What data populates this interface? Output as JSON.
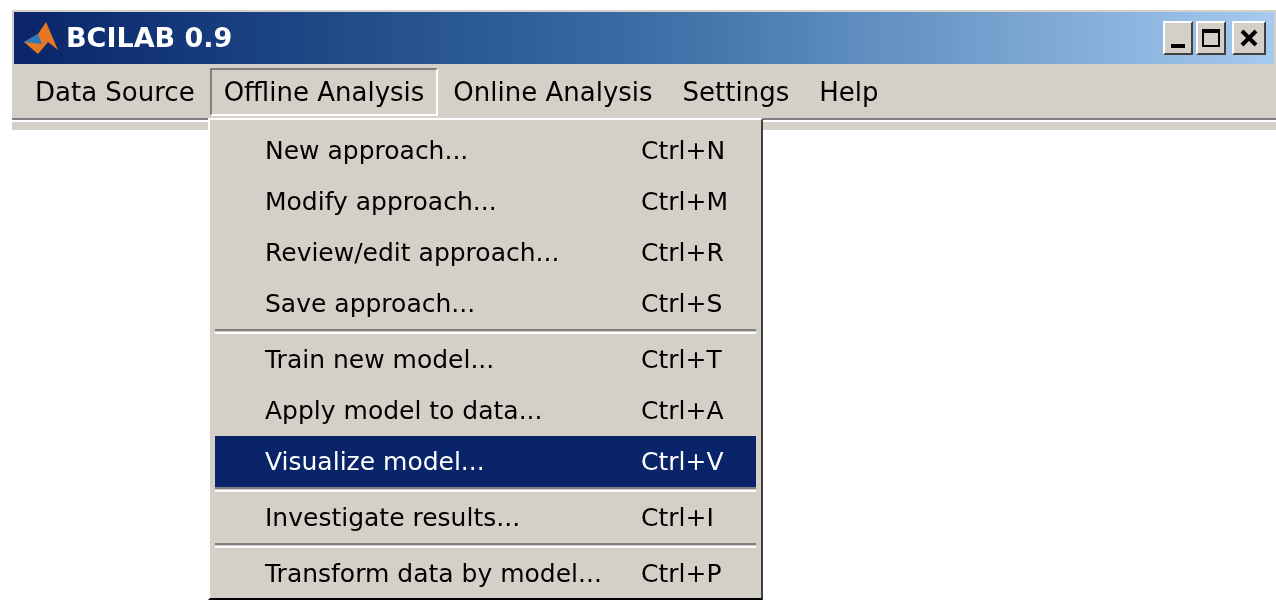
{
  "window": {
    "title": "BCILAB 0.9"
  },
  "menubar": [
    {
      "label": "Data Source",
      "selected": false
    },
    {
      "label": "Offline Analysis",
      "selected": true
    },
    {
      "label": "Online Analysis",
      "selected": false
    },
    {
      "label": "Settings",
      "selected": false
    },
    {
      "label": "Help",
      "selected": false
    }
  ],
  "dropdown": [
    {
      "kind": "item",
      "label": "New approach...",
      "shortcut": "Ctrl+N",
      "selected": false
    },
    {
      "kind": "item",
      "label": "Modify approach...",
      "shortcut": "Ctrl+M",
      "selected": false
    },
    {
      "kind": "item",
      "label": "Review/edit approach...",
      "shortcut": "Ctrl+R",
      "selected": false
    },
    {
      "kind": "item",
      "label": "Save approach...",
      "shortcut": "Ctrl+S",
      "selected": false
    },
    {
      "kind": "separator"
    },
    {
      "kind": "item",
      "label": "Train new model...",
      "shortcut": "Ctrl+T",
      "selected": false
    },
    {
      "kind": "item",
      "label": "Apply model to data...",
      "shortcut": "Ctrl+A",
      "selected": false
    },
    {
      "kind": "item",
      "label": "Visualize model...",
      "shortcut": "Ctrl+V",
      "selected": true
    },
    {
      "kind": "separator"
    },
    {
      "kind": "item",
      "label": "Investigate results...",
      "shortcut": "Ctrl+I",
      "selected": false
    },
    {
      "kind": "separator"
    },
    {
      "kind": "item",
      "label": "Transform data by model...",
      "shortcut": "Ctrl+P",
      "selected": false
    }
  ]
}
